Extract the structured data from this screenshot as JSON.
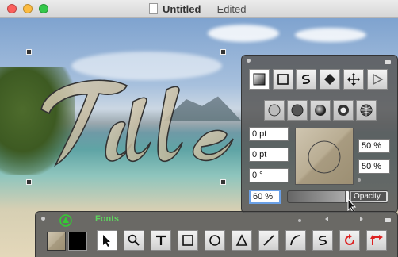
{
  "window": {
    "title_name": "Untitled",
    "title_status": "— Edited"
  },
  "inspector": {
    "top_tools": [
      "gradient-tool",
      "square-tool",
      "s-curve-tool",
      "diamond-tool",
      "move-tool",
      "play-tool"
    ],
    "shape_tools": [
      "circle-outline-tool",
      "circle-filled-tool",
      "circle-shaded-tool",
      "circle-ring-tool",
      "globe-tool"
    ],
    "fields": {
      "field1": "0 pt",
      "field2": "0 pt",
      "field3": "0 °"
    },
    "right_fields": {
      "percent1": "50 %",
      "percent2": "50 %"
    },
    "opacity": {
      "value_text": "60 %",
      "label": "Opacity",
      "value": 0.6
    }
  },
  "toolbar": {
    "fonts_label": "Fonts",
    "tools": [
      "arrow-tool",
      "zoom-tool",
      "text-tool",
      "rect-tool",
      "circle-tool",
      "triangle-tool",
      "line-tool",
      "arc-tool",
      "s-curve-tool",
      "rotate-tool",
      "flip-tool"
    ]
  }
}
